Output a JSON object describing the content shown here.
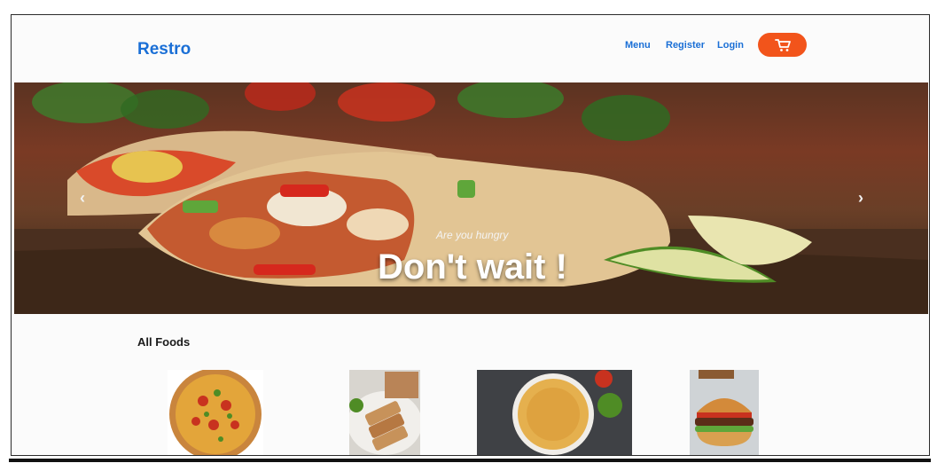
{
  "header": {
    "brand": "Restro",
    "nav": {
      "menu": "Menu",
      "register": "Register",
      "login": "Login"
    },
    "cart_icon": "cart-icon",
    "accent_color": "#1a6fd6",
    "cart_color": "#f2541b"
  },
  "hero": {
    "subtitle": "Are you hungry",
    "title": "Don't wait !",
    "prev_icon": "chevron-left-icon",
    "next_icon": "chevron-right-icon"
  },
  "foods": {
    "title": "All Foods",
    "items": [
      {
        "image": "pizza-image"
      },
      {
        "image": "sandwich-image"
      },
      {
        "image": "noodles-image"
      },
      {
        "image": "burger-image"
      }
    ]
  }
}
